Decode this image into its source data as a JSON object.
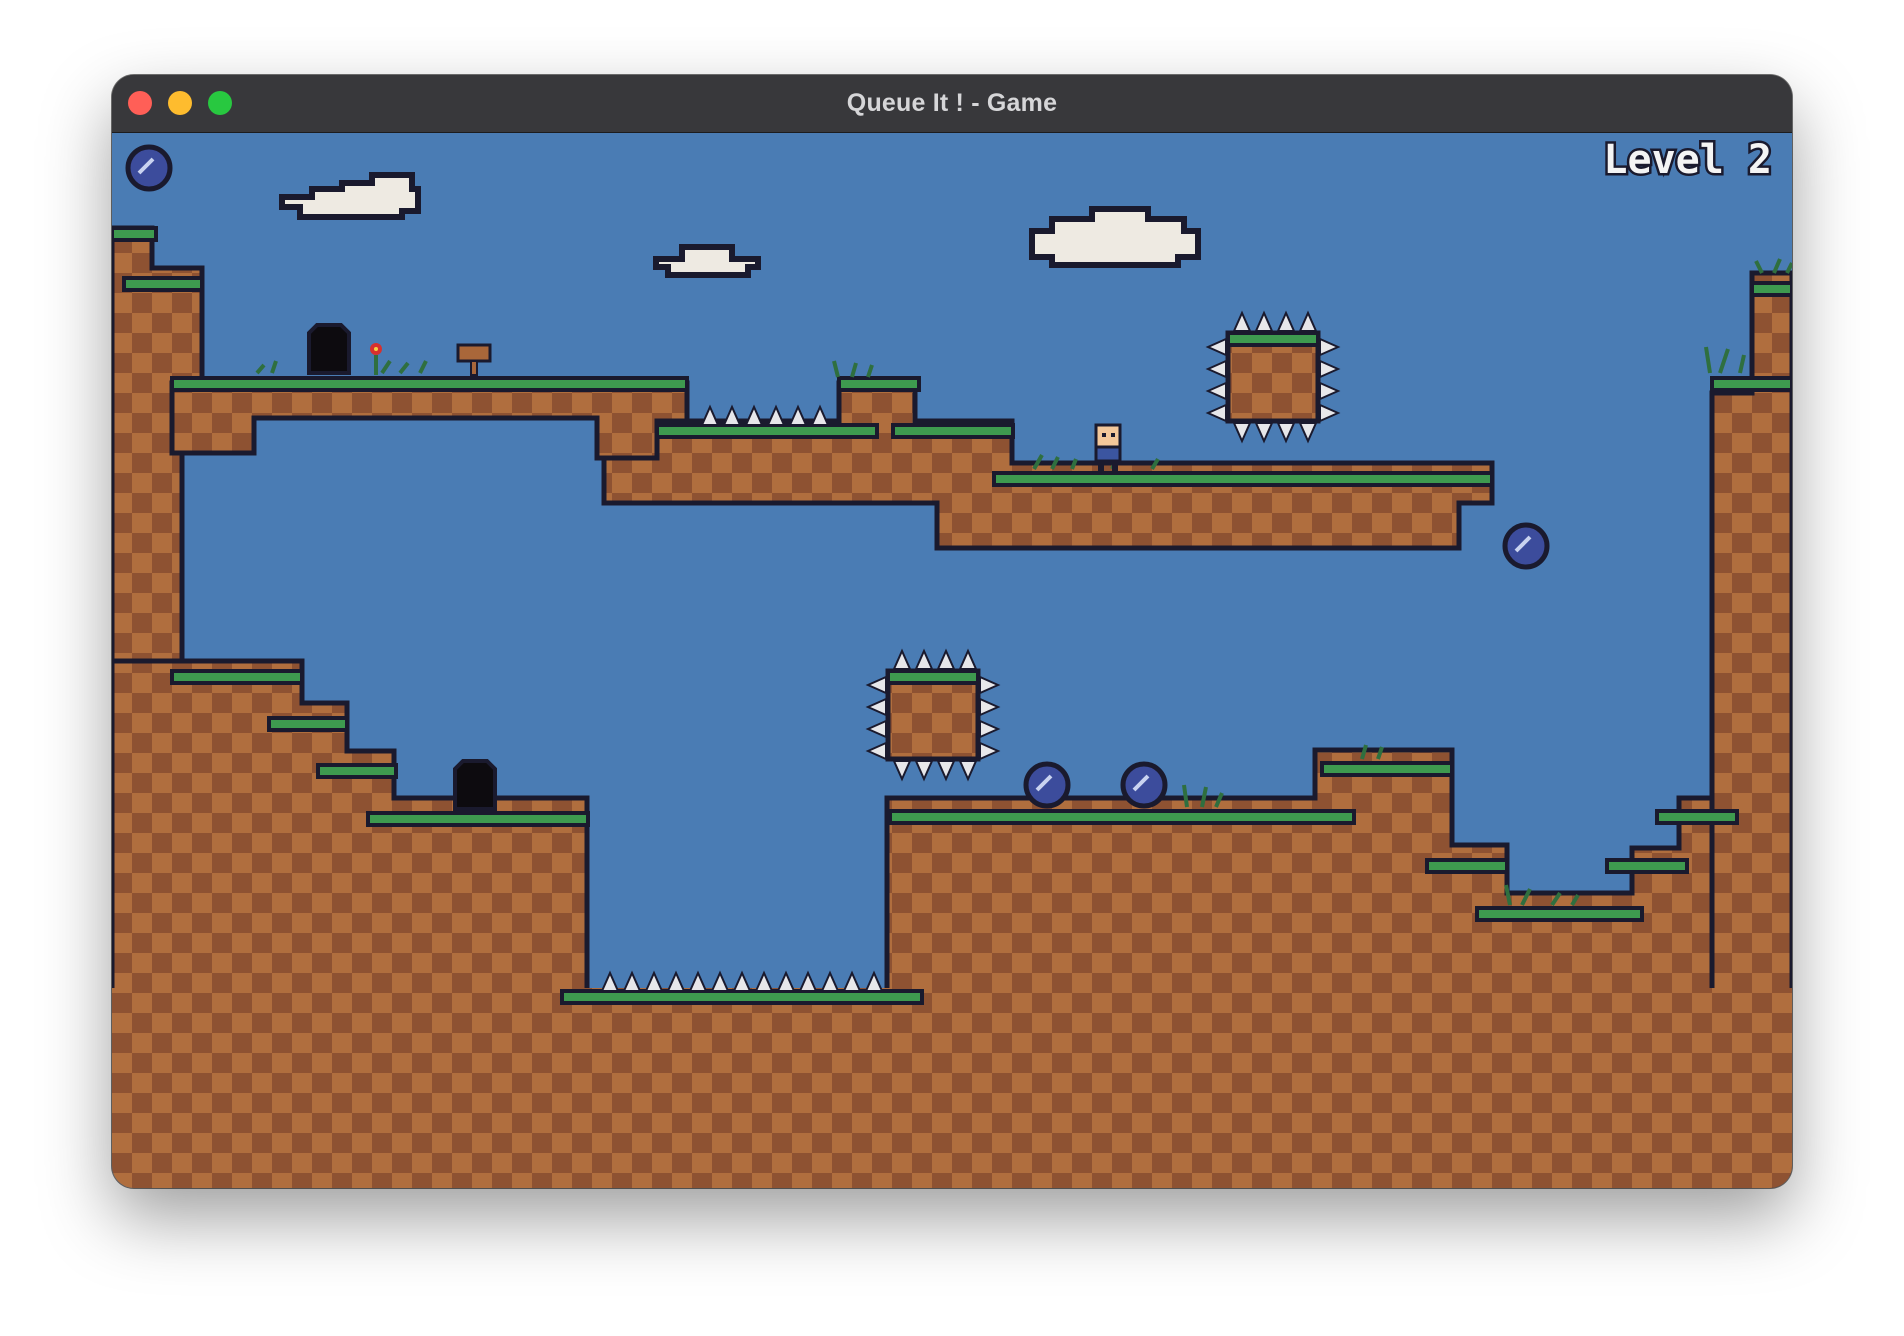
{
  "window": {
    "title": "Queue It ! - Game"
  },
  "hud": {
    "level_label": "Level 2",
    "orb_icon": "orb-icon"
  },
  "colors": {
    "sky": "#4a7cb4",
    "dirt_light": "#b06e3e",
    "dirt_dark": "#8e5232",
    "grass": "#3e9a4f",
    "grass_light": "#5cb864",
    "outline": "#1a1a2e",
    "spike": "#e7e7ea",
    "cloud": "#eeeae2",
    "orb": "#3c4c9c",
    "door": "#0d0b0f",
    "titlebar": "#38383b"
  }
}
